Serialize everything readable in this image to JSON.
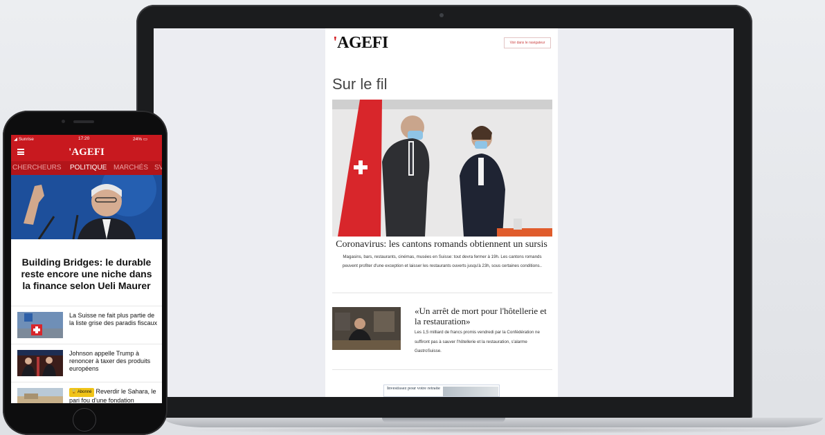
{
  "newsletter": {
    "logo": "AGEFI",
    "logo_mark": "'",
    "browser_link": "Voir dans le navigateur",
    "section_title": "Sur le fil",
    "lead_story": {
      "title": "Coronavirus: les cantons romands obtiennent un sursis",
      "summary": "Magasins, bars, restaurants, cinémas, musées en Suisse: tout devra fermer à 19h. Les cantons romands peuvent profiter d'une exception et laisser les restaurants ouverts jusqu'à 23h, sous certaines conditions.."
    },
    "second_story": {
      "title": "«Un arrêt de mort pour l'hôtellerie et la restauration»",
      "summary": "Les 1,5 milliard de francs promis vendredi par la Confédération ne suffiront pas à sauver l'hôtellerie et la restauration, s'alarme GastroSuisse."
    },
    "ad": {
      "text": "Investissez pour votre retraite"
    }
  },
  "phone": {
    "status": {
      "carrier": "Sunrise",
      "time": "17:20",
      "battery": "24%"
    },
    "logo": "AGEFI",
    "logo_mark": "'",
    "tabs": [
      "CHERCHEURS",
      "POLITIQUE",
      "MARCHÉS",
      "SV"
    ],
    "active_tab": "POLITIQUE",
    "headline": "Building Bridges: le durable reste encore une niche dans la finance selon Ueli Maurer",
    "news": [
      {
        "title": "La Suisse ne fait plus partie de la liste grise des paradis fiscaux"
      },
      {
        "title": "Johnson appelle Trump à renoncer à taxer des produits européens"
      },
      {
        "badge": "Abonné",
        "title": "Reverdir le Sahara, le pari fou d'une fondation"
      }
    ]
  },
  "colors": {
    "brand_red": "#c8191f",
    "brand_dark_red": "#b2151a"
  }
}
